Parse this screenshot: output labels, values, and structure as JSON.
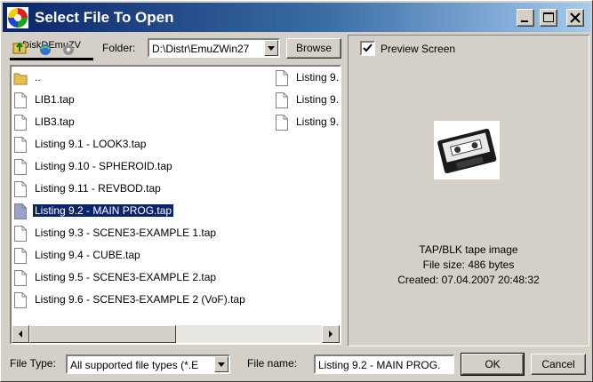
{
  "window": {
    "title": "Select File To Open",
    "colors": {
      "titlebar_start": "#0a246a",
      "titlebar_end": "#a6caf0",
      "selection": "#0a246a",
      "face": "#d4d0c8"
    }
  },
  "toolbar": {
    "drive_strip_text": "DiskDEmuZV",
    "folder_label": "Folder:",
    "folder_value": "D:\\Distr\\EmuZWin27",
    "browse_label": "Browse"
  },
  "files": {
    "left_column": [
      {
        "name": "..",
        "icon": "folder-icon",
        "selected": false
      },
      {
        "name": "LIB1.tap",
        "icon": "file-icon",
        "selected": false
      },
      {
        "name": "LIB3.tap",
        "icon": "file-icon",
        "selected": false
      },
      {
        "name": "Listing 9.1 - LOOK3.tap",
        "icon": "file-icon",
        "selected": false
      },
      {
        "name": "Listing 9.10 - SPHEROID.tap",
        "icon": "file-icon",
        "selected": false
      },
      {
        "name": "Listing 9.11 - REVBOD.tap",
        "icon": "file-icon",
        "selected": false
      },
      {
        "name": "Listing 9.2 - MAIN PROG.tap",
        "icon": "file-icon",
        "selected": true
      },
      {
        "name": "Listing 9.3 - SCENE3-EXAMPLE 1.tap",
        "icon": "file-icon",
        "selected": false
      },
      {
        "name": "Listing 9.4 - CUBE.tap",
        "icon": "file-icon",
        "selected": false
      },
      {
        "name": "Listing 9.5 - SCENE3-EXAMPLE 2.tap",
        "icon": "file-icon",
        "selected": false
      },
      {
        "name": "Listing 9.6 - SCENE3-EXAMPLE 2 (VoF).tap",
        "icon": "file-icon",
        "selected": false
      }
    ],
    "right_column": [
      {
        "name": "Listing 9.",
        "icon": "file-icon"
      },
      {
        "name": "Listing 9.",
        "icon": "file-icon"
      },
      {
        "name": "Listing 9.",
        "icon": "file-icon"
      }
    ]
  },
  "preview": {
    "checkbox_label": "Preview Screen",
    "checked": true,
    "image_icon": "cassette-tape-icon",
    "info_type": "TAP/BLK tape image",
    "info_size": "File size: 486 bytes",
    "info_created": "Created: 07.04.2007 20:48:32"
  },
  "bottom": {
    "file_type_label": "File Type:",
    "file_type_value": "All supported file types (*.E",
    "file_name_label": "File name:",
    "file_name_value": "Listing 9.2 - MAIN PROG.",
    "ok_label": "OK",
    "cancel_label": "Cancel"
  }
}
